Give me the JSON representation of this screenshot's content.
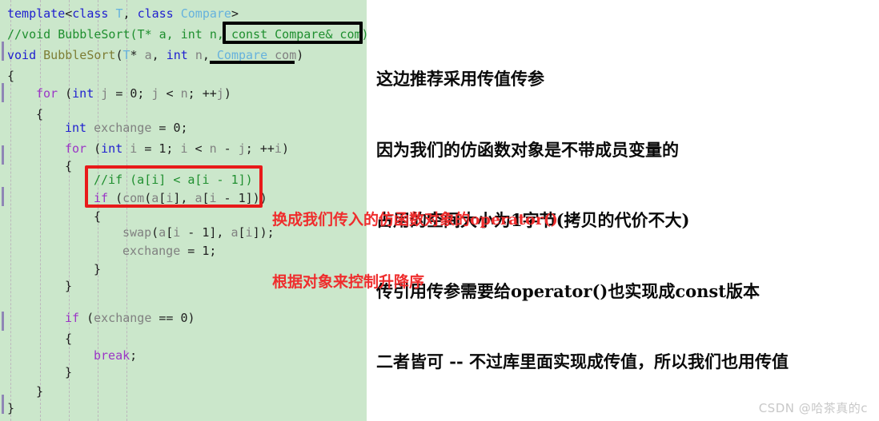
{
  "editor": {
    "background_color": "#cbe7cb",
    "pane_width": 458,
    "line_height": 26,
    "lines": [
      {
        "indent": 0,
        "text": "template<class T, class Compare>"
      },
      {
        "indent": 0,
        "text": "//void BubbleSort(T* a, int n, const Compare& com)"
      },
      {
        "indent": 0,
        "text": "void BubbleSort(T* a, int n, Compare com)"
      },
      {
        "indent": 0,
        "text": "{"
      },
      {
        "indent": 1,
        "text": "for (int j = 0; j < n; ++j)"
      },
      {
        "indent": 1,
        "text": "{"
      },
      {
        "indent": 0,
        "text": ""
      },
      {
        "indent": 2,
        "text": "int exchange = 0;"
      },
      {
        "indent": 2,
        "text": "for (int i = 1; i < n - j; ++i)"
      },
      {
        "indent": 2,
        "text": "{"
      },
      {
        "indent": 0,
        "text": ""
      },
      {
        "indent": 3,
        "text": "//if (a[i] < a[i - 1])"
      },
      {
        "indent": 3,
        "text": "if (com(a[i], a[i - 1]))"
      },
      {
        "indent": 3,
        "text": "{"
      },
      {
        "indent": 4,
        "text": "swap(a[i - 1], a[i]);"
      },
      {
        "indent": 4,
        "text": "exchange = 1;"
      },
      {
        "indent": 3,
        "text": "}"
      },
      {
        "indent": 2,
        "text": "}"
      },
      {
        "indent": 0,
        "text": ""
      },
      {
        "indent": 2,
        "text": "if (exchange == 0)"
      },
      {
        "indent": 2,
        "text": "{"
      },
      {
        "indent": 3,
        "text": "break;"
      },
      {
        "indent": 2,
        "text": "}"
      },
      {
        "indent": 1,
        "text": "}"
      },
      {
        "indent": 0,
        "text": "}"
      }
    ],
    "token_colors": {
      "keyword": "#1f1fd0",
      "control": "#9b36c6",
      "comment": "#1f8f2f",
      "function": "#7d7d34",
      "identifier": "#808080",
      "class": "#66b2dd",
      "punctuation": "#202020"
    }
  },
  "highlights": {
    "black_box_label": "const Compare& com)",
    "black_underline_label": "Compare com",
    "red_box_lines": [
      "//if (a[i] < a[i - 1])",
      "if (com(a[i], a[i - 1]))"
    ],
    "black_box_color": "#000000",
    "red_box_color": "#e81a1a"
  },
  "annotations": {
    "black_note_color": "#0a0a0a",
    "black_note": [
      "这边推荐采用传值传参",
      "因为我们的仿函数对象是不带成员变量的",
      "占用的空间大小为1字节(拷贝的代价不大)",
      "传引用传参需要给operator()也实现成const版本",
      "二者皆可 -- 不过库里面实现成传值，所以我们也用传值"
    ],
    "red_note_color": "#ef2d2d",
    "red_note": [
      "换成我们传入的仿函数对象的operator()",
      "根据对象来控制升降序"
    ]
  },
  "watermark": {
    "text": "CSDN @哈茶真的c",
    "color": "#c8c8c8"
  }
}
